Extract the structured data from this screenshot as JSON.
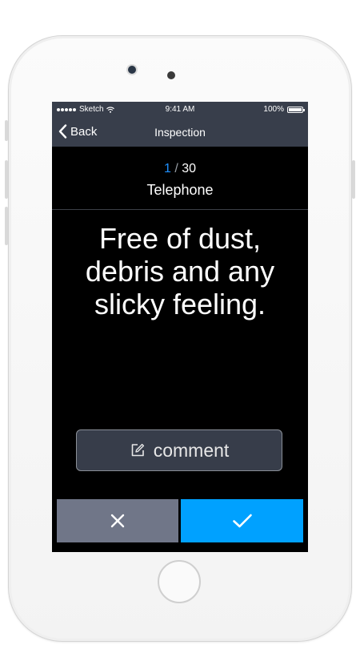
{
  "status_bar": {
    "carrier": "Sketch",
    "time": "9:41 AM",
    "battery": "100%",
    "icons": [
      "signal-icon",
      "wifi-icon",
      "battery-icon"
    ]
  },
  "nav": {
    "back_label": "Back",
    "title": "Inspection"
  },
  "progress": {
    "current": "1",
    "separator": "/",
    "total": "30"
  },
  "category": "Telephone",
  "question": "Free of dust, debris and any slicky feeling.",
  "comment": {
    "label": "comment",
    "icon": "edit-icon"
  },
  "actions": {
    "reject_icon": "close-icon",
    "approve_icon": "checkmark-icon"
  },
  "colors": {
    "bar": "#383e4b",
    "accent": "#00a1ff",
    "progress_accent": "#1e90ff",
    "reject": "#707688",
    "screen": "#000000"
  }
}
